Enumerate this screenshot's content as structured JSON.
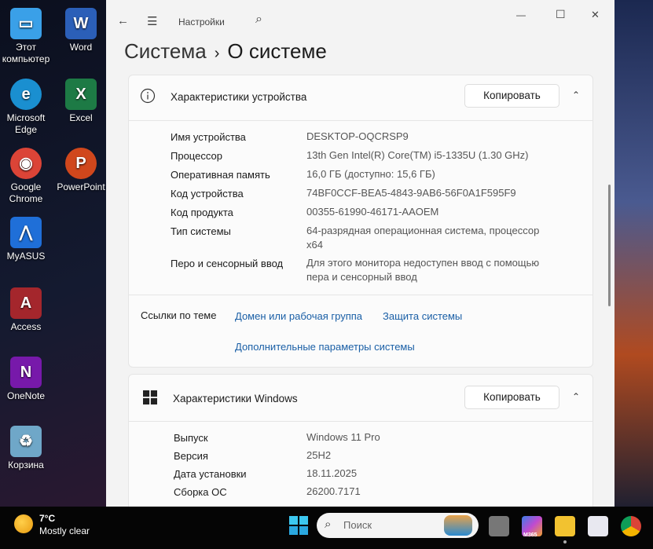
{
  "desktop": {
    "icons": [
      {
        "label": "Этот компьютер",
        "color": "#3aa0e8",
        "glyph": "▭"
      },
      {
        "label": "Word",
        "color": "#2b5fb8",
        "glyph": "W"
      },
      {
        "label": "Microsoft Edge",
        "color": "#1a8fd0",
        "glyph": "e"
      },
      {
        "label": "Excel",
        "color": "#1d7a45",
        "glyph": "X"
      },
      {
        "label": "Google Chrome",
        "color": "#db4437",
        "glyph": "◉"
      },
      {
        "label": "PowerPoint",
        "color": "#d0471c",
        "glyph": "P"
      },
      {
        "label": "MyASUS",
        "color": "#1f6fd8",
        "glyph": "⋀"
      },
      {
        "label": "Access",
        "color": "#a4262c",
        "glyph": "A"
      },
      {
        "label": "OneNote",
        "color": "#7719aa",
        "glyph": "N"
      },
      {
        "label": "Корзина",
        "color": "#6fa7c8",
        "glyph": "♻"
      }
    ]
  },
  "window": {
    "titlebar": {
      "title": "Настройки",
      "back": "←",
      "menu": "☰",
      "search": "⌕",
      "minimize": "—",
      "maximize": "☐",
      "close": "✕"
    },
    "breadcrumb": {
      "parent": "Система",
      "separator": "›",
      "current": "О системе"
    },
    "device_card": {
      "title": "Характеристики устройства",
      "copy": "Копировать",
      "chevron": "⌃",
      "rows": [
        {
          "label": "Имя устройства",
          "value": "DESKTOP-OQCRSP9"
        },
        {
          "label": "Процессор",
          "value": "13th Gen Intel(R) Core(TM) i5-1335U (1.30 GHz)"
        },
        {
          "label": "Оперативная память",
          "value": "16,0 ГБ (доступно: 15,6 ГБ)"
        },
        {
          "label": "Код устройства",
          "value": "74BF0CCF-BEA5-4843-9AB6-56F0A1F595F9"
        },
        {
          "label": "Код продукта",
          "value": "00355-61990-46171-AAOEM"
        },
        {
          "label": "Тип системы",
          "value": "64-разрядная операционная система, процессор x64"
        },
        {
          "label": "Перо и сенсорный ввод",
          "value": "Для этого монитора недоступен ввод с помощью пера и сенсорный ввод"
        }
      ],
      "links_label": "Ссылки по теме",
      "links": [
        "Домен или рабочая группа",
        "Защита системы",
        "Дополнительные параметры системы"
      ]
    },
    "windows_card": {
      "title": "Характеристики Windows",
      "copy": "Копировать",
      "chevron": "⌃",
      "rows": [
        {
          "label": "Выпуск",
          "value": "Windows 11 Pro"
        },
        {
          "label": "Версия",
          "value": "25H2"
        },
        {
          "label": "Дата установки",
          "value": "18.11.2025"
        },
        {
          "label": "Сборка ОС",
          "value": "26200.7171"
        }
      ]
    }
  },
  "taskbar": {
    "weather_temp": "7°C",
    "weather_desc": "Mostly clear",
    "search_placeholder": "Поиск",
    "m365": "M365"
  }
}
